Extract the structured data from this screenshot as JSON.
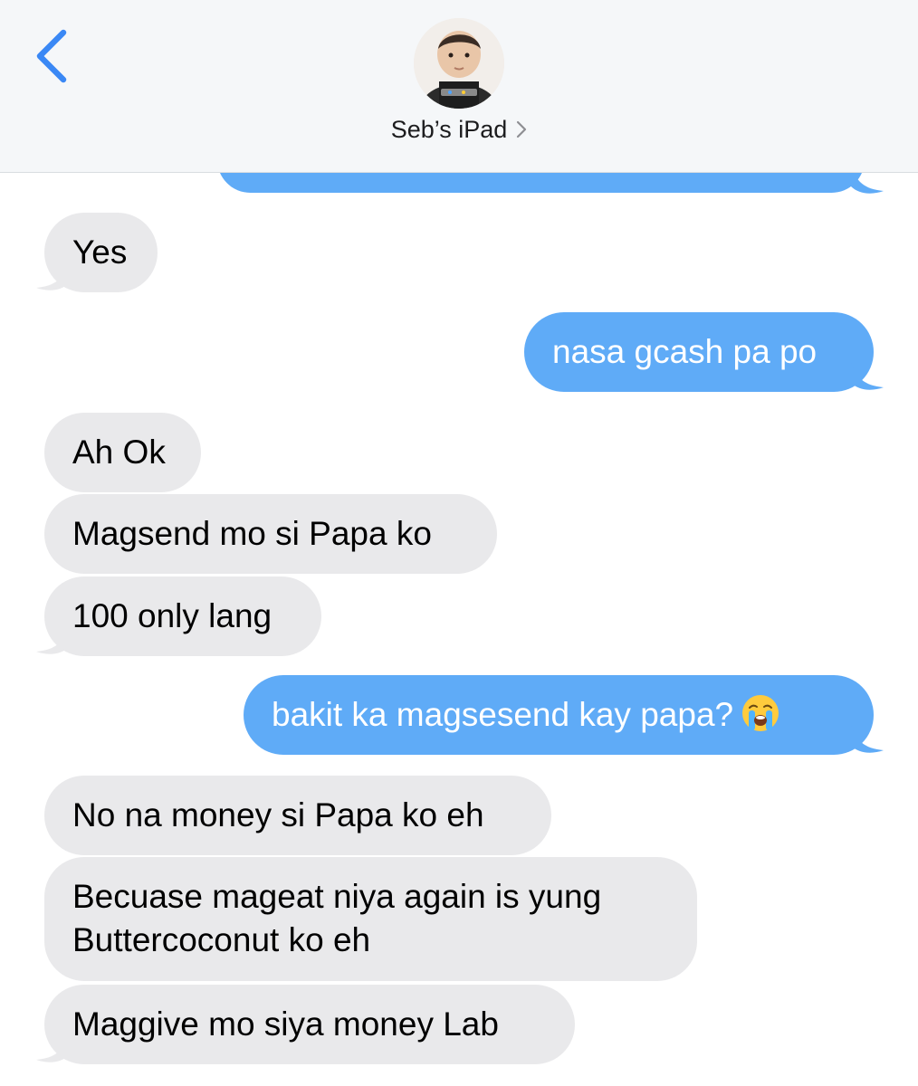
{
  "header": {
    "contact_name": "Seb’s iPad",
    "back_icon": "chevron-left-icon",
    "contact_chevron_icon": "chevron-right-icon",
    "avatar": "contact-photo"
  },
  "colors": {
    "sent_bubble": "#5fabf7",
    "received_bubble": "#e9e9eb",
    "accent": "#3a88f5"
  },
  "messages": [
    {
      "direction": "received",
      "text": "Yes"
    },
    {
      "direction": "sent",
      "text": "nasa gcash pa po"
    },
    {
      "direction": "received",
      "text": "Ah Ok"
    },
    {
      "direction": "received",
      "text": "Magsend mo si Papa ko"
    },
    {
      "direction": "received",
      "text": "100 only lang"
    },
    {
      "direction": "sent",
      "text": "bakit ka magsesend kay papa?",
      "emoji": "loudly-crying-face-emoji"
    },
    {
      "direction": "received",
      "text": "No na money si Papa ko eh"
    },
    {
      "direction": "received",
      "line1": "Becuase mageat niya again is yung",
      "line2": "Buttercoconut ko eh"
    },
    {
      "direction": "received",
      "text": "Maggive mo siya money Lab"
    }
  ]
}
